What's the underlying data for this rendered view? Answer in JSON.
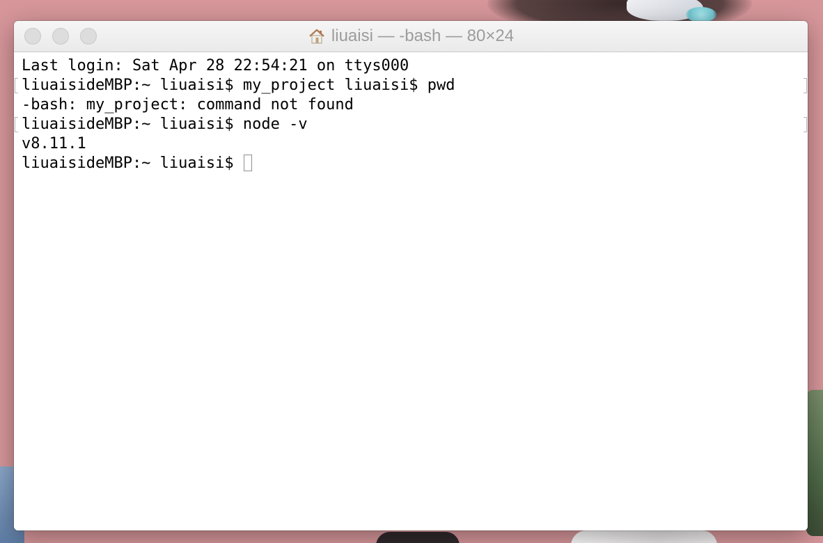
{
  "window": {
    "title": "liuaisi — -bash — 80×24",
    "title_icon": "home-icon"
  },
  "terminal": {
    "lines": [
      {
        "text": "Last login: Sat Apr 28 22:54:21 on ttys000",
        "marked": false
      },
      {
        "text": "liuaisideMBP:~ liuaisi$ my_project liuaisi$ pwd",
        "marked": true
      },
      {
        "text": "-bash: my_project: command not found",
        "marked": false
      },
      {
        "text": "liuaisideMBP:~ liuaisi$ node -v",
        "marked": true
      },
      {
        "text": "v8.11.1",
        "marked": false
      },
      {
        "text": "liuaisideMBP:~ liuaisi$ ",
        "marked": false
      }
    ],
    "cursor": "block"
  }
}
